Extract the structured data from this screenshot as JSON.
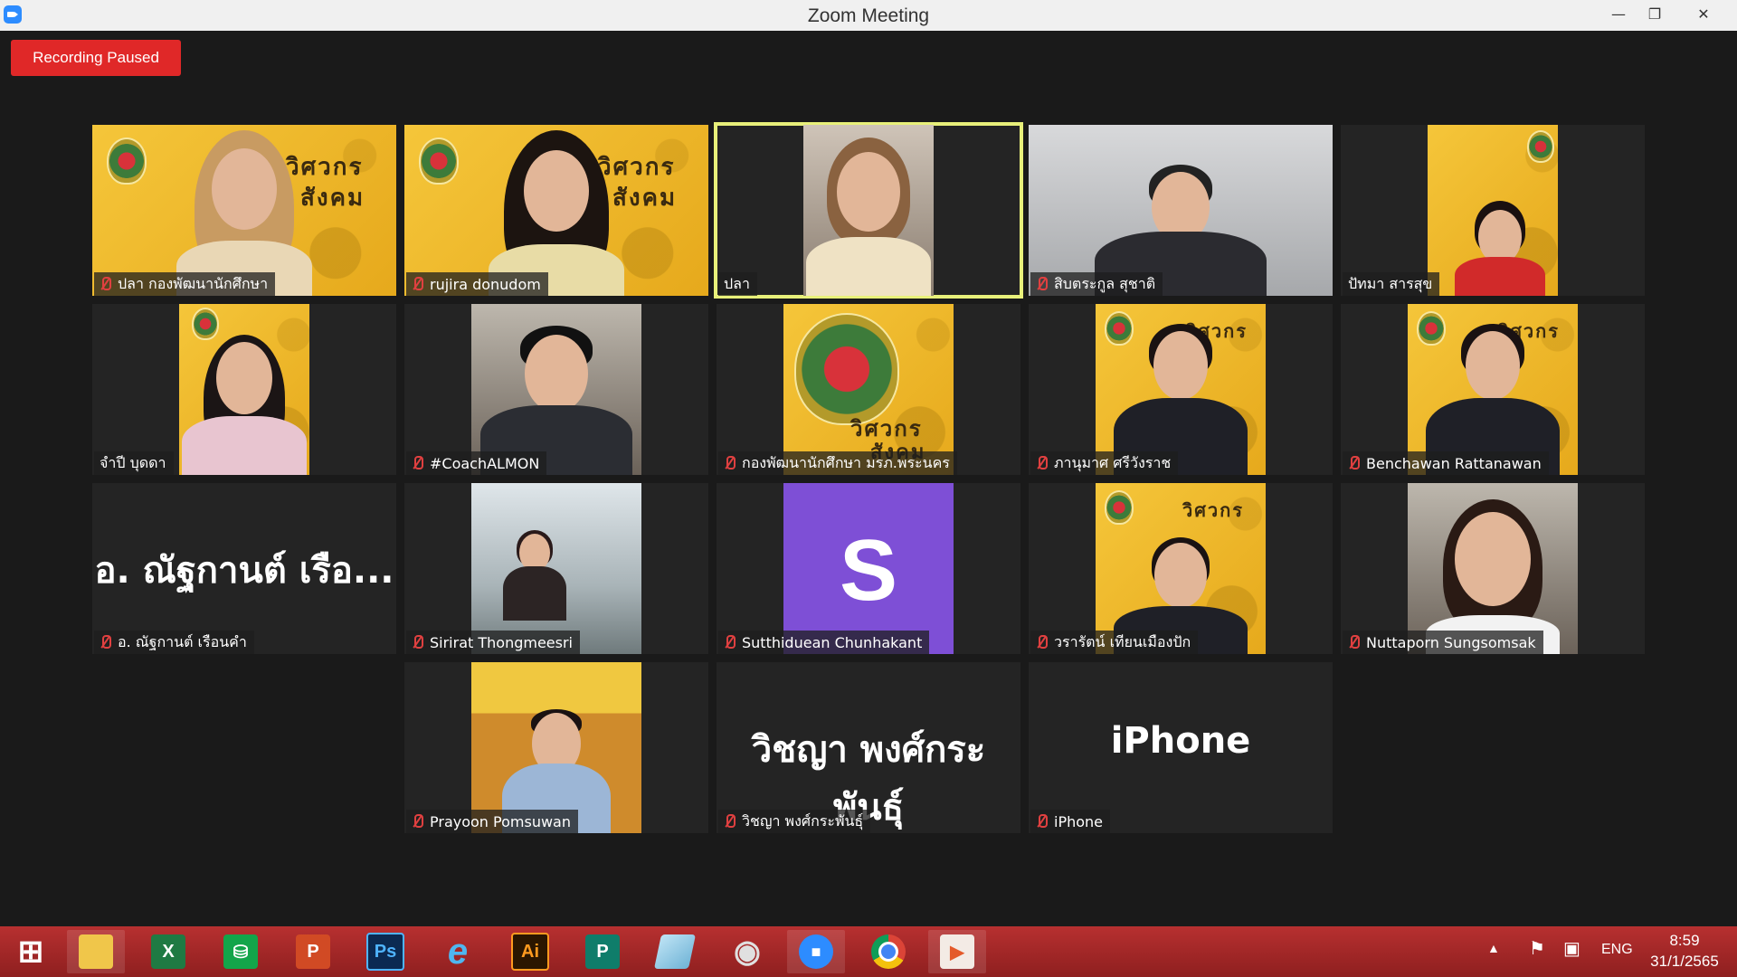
{
  "window": {
    "title": "Zoom Meeting",
    "minimize_glyph": "—",
    "restore_glyph": "❐",
    "close_glyph": "✕"
  },
  "recording": {
    "label": "Recording Paused"
  },
  "participants": [
    {
      "name": "ปลา กองพัฒนานักศึกษา",
      "muted": true
    },
    {
      "name": "rujira donudom",
      "muted": true
    },
    {
      "name": "ปลา",
      "muted": false,
      "active_speaker": true
    },
    {
      "name": "สิบตระกูล สุชาติ",
      "muted": true
    },
    {
      "name": "ปัทมา สารสุข",
      "muted": false
    },
    {
      "name": "จำปี บุดดา",
      "muted": false
    },
    {
      "name": "#CoachALMON",
      "muted": true
    },
    {
      "name": "กองพัฒนานักศึกษา มรภ.พระนคร",
      "muted": true
    },
    {
      "name": "ภานุมาศ ศรีวังราช",
      "muted": true
    },
    {
      "name": "Benchawan Rattanawan",
      "muted": true
    },
    {
      "name": "อ. ณัฐกานต์ เรือนคำ",
      "muted": true,
      "display_text": "อ. ณัฐกานต์  เรือ..."
    },
    {
      "name": "Sirirat Thongmeesri",
      "muted": true
    },
    {
      "name": "Sutthiduean Chunhakant",
      "muted": true,
      "avatar_letter": "S"
    },
    {
      "name": "วรารัตน์ เทียนเมืองปัก",
      "muted": true
    },
    {
      "name": "Nuttaporn Sungsomsak",
      "muted": true
    },
    {
      "name": "Prayoon Pomsuwan",
      "muted": true
    },
    {
      "name": "วิชญา พงศ์กระพันธุ์",
      "muted": true,
      "display_text": "วิชญา พงศ์กระพันธุ์"
    },
    {
      "name": "iPhone",
      "muted": true,
      "display_text": "iPhone"
    }
  ],
  "banner": {
    "line1": "วิศวกร",
    "line2": "สังคม"
  },
  "taskbar": {
    "apps": [
      {
        "name": "start",
        "glyph": "⊞"
      },
      {
        "name": "file-explorer",
        "glyph": ""
      },
      {
        "name": "excel",
        "glyph": "X"
      },
      {
        "name": "store",
        "glyph": "⛁"
      },
      {
        "name": "powerpoint",
        "glyph": "P"
      },
      {
        "name": "photoshop",
        "glyph": "Ps"
      },
      {
        "name": "internet-explorer",
        "glyph": "e"
      },
      {
        "name": "illustrator",
        "glyph": "Ai"
      },
      {
        "name": "publisher",
        "glyph": "P"
      },
      {
        "name": "notepad",
        "glyph": ""
      },
      {
        "name": "photoscape",
        "glyph": "◉"
      },
      {
        "name": "zoom",
        "glyph": "■"
      },
      {
        "name": "chrome",
        "glyph": ""
      },
      {
        "name": "video-app",
        "glyph": "▶"
      }
    ],
    "language": "ENG",
    "time": "8:59",
    "date": "31/1/2565"
  },
  "colors": {
    "accent_active": "#e8f07a",
    "recording": "#e02828",
    "taskbar": "#a52828",
    "avatar_purple": "#7e4fd6"
  }
}
